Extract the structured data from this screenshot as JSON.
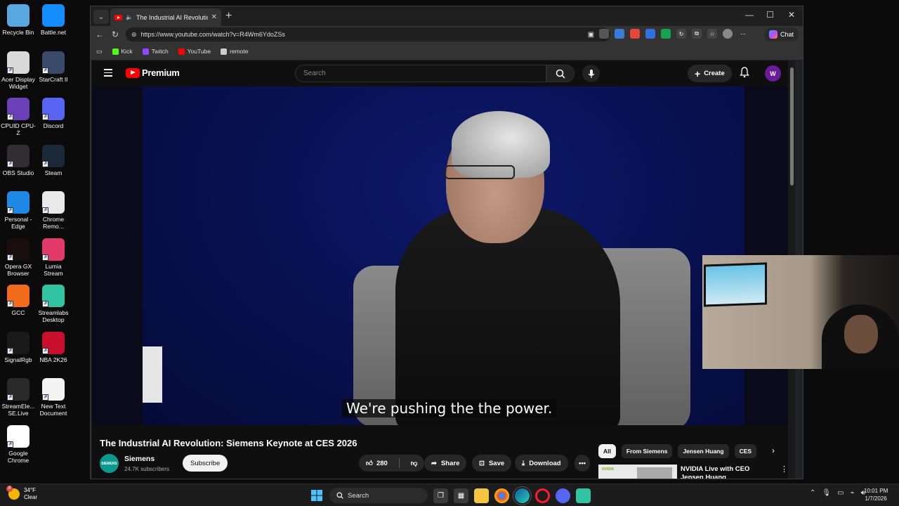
{
  "desktop": {
    "icons": [
      {
        "label": "Recycle Bin",
        "color": "#5aa7e0"
      },
      {
        "label": "Battle.net",
        "color": "#148eff"
      },
      {
        "label": "Acer Display Widget",
        "color": "#d9d9d9"
      },
      {
        "label": "StarCraft II",
        "color": "#3a4a6a"
      },
      {
        "label": "CPUID CPU-Z",
        "color": "#6a3fb8"
      },
      {
        "label": "Discord",
        "color": "#5865f2"
      },
      {
        "label": "OBS Studio",
        "color": "#302e31"
      },
      {
        "label": "Steam",
        "color": "#1b2838"
      },
      {
        "label": "Personal - Edge",
        "color": "#1e88e5"
      },
      {
        "label": "Chrome Remo...",
        "color": "#e9e9e9"
      },
      {
        "label": "Opera GX Browser",
        "color": "#1a0d10"
      },
      {
        "label": "Lumia Stream",
        "color": "#e23b6a"
      },
      {
        "label": "GCC",
        "color": "#f26b1d"
      },
      {
        "label": "Streamlabs Desktop",
        "color": "#31c3a2"
      },
      {
        "label": "SignalRgb",
        "color": "#1a1a1a"
      },
      {
        "label": "NBA 2K26",
        "color": "#c8102e"
      },
      {
        "label": "StreamEle... SE.Live",
        "color": "#2a2a2a"
      },
      {
        "label": "New Text Document",
        "color": "#f4f4f4"
      },
      {
        "label": "Google Chrome",
        "color": "#ffffff"
      }
    ]
  },
  "browser": {
    "tab_title": "The Industrial AI Revolution: S",
    "url": "https://www.youtube.com/watch?v=R4Wm6YdoZSs",
    "chat_label": "Chat",
    "bookmarks": [
      {
        "label": "Kick",
        "color": "#53fc18"
      },
      {
        "label": "Twitch",
        "color": "#9146ff"
      },
      {
        "label": "YouTube",
        "color": "#ff0000"
      },
      {
        "label": "remote",
        "color": "#cccccc"
      }
    ]
  },
  "youtube": {
    "logo_text": "Premium",
    "search_placeholder": "Search",
    "create_label": "Create",
    "avatar_letter": "W",
    "caption": "We're pushing the the power.",
    "video_title": "The Industrial AI Revolution: Siemens Keynote at CES 2026",
    "channel": {
      "name": "Siemens",
      "avatar_text": "SIEMENS",
      "subscribers": "24.7K subscribers"
    },
    "subscribe_label": "Subscribe",
    "like_count": "280",
    "share_label": "Share",
    "save_label": "Save",
    "download_label": "Download",
    "chips": [
      "All",
      "From Siemens",
      "Jensen Huang",
      "CES"
    ],
    "recommended": {
      "title": "NVIDIA Live with CEO Jensen Huang",
      "thumb_label": "NVIDIA"
    }
  },
  "taskbar": {
    "weather_temp": "34°F",
    "weather_desc": "Clear",
    "weather_badge": "8",
    "search_label": "Search",
    "time": "10:01 PM",
    "date": "1/7/2026"
  }
}
